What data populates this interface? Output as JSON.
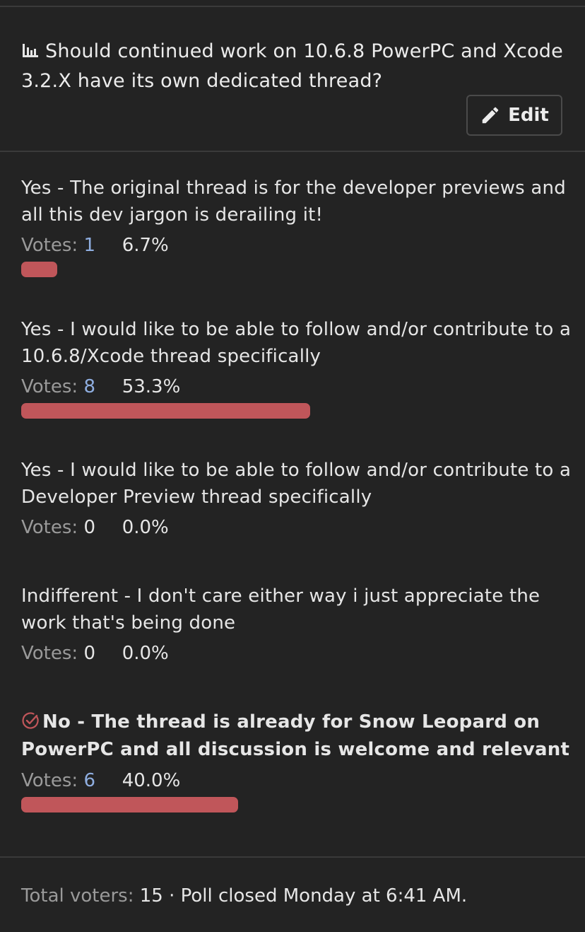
{
  "poll": {
    "icon": "bar-chart-icon",
    "question": "Should continued work on 10.6.8 PowerPC and Xcode 3.2.X have its own dedicated thread?",
    "edit_label": "Edit",
    "edit_icon": "pencil-icon"
  },
  "options": [
    {
      "text": "Yes - The original thread is for the developer previews and all this dev jargon is derailing it!",
      "votes_label": "Votes:",
      "votes": "1",
      "percent": "6.7%",
      "fraction": 0.067,
      "selected": false
    },
    {
      "text": "Yes - I would like to be able to follow and/or contribute to a 10.6.8/Xcode thread specifically",
      "votes_label": "Votes:",
      "votes": "8",
      "percent": "53.3%",
      "fraction": 0.533,
      "selected": false
    },
    {
      "text": "Yes - I would like to be able to follow and/or contribute to a Developer Preview thread specifically",
      "votes_label": "Votes:",
      "votes": "0",
      "percent": "0.0%",
      "fraction": 0,
      "selected": false
    },
    {
      "text": "Indifferent - I don't care either way i just appreciate the work that's being done",
      "votes_label": "Votes:",
      "votes": "0",
      "percent": "0.0%",
      "fraction": 0,
      "selected": false
    },
    {
      "text": "No - The thread is already for Snow Leopard on PowerPC and all discussion is welcome and relevant",
      "votes_label": "Votes:",
      "votes": "6",
      "percent": "40.0%",
      "fraction": 0.4,
      "selected": true
    }
  ],
  "footer": {
    "total_label": "Total voters:",
    "total_value": "15",
    "separator": "·",
    "closed_text": "Poll closed Monday at 6:41 AM."
  },
  "colors": {
    "background": "#232323",
    "bar": "#c0565a",
    "vote_link": "#8faee0",
    "check": "#c0565a"
  }
}
